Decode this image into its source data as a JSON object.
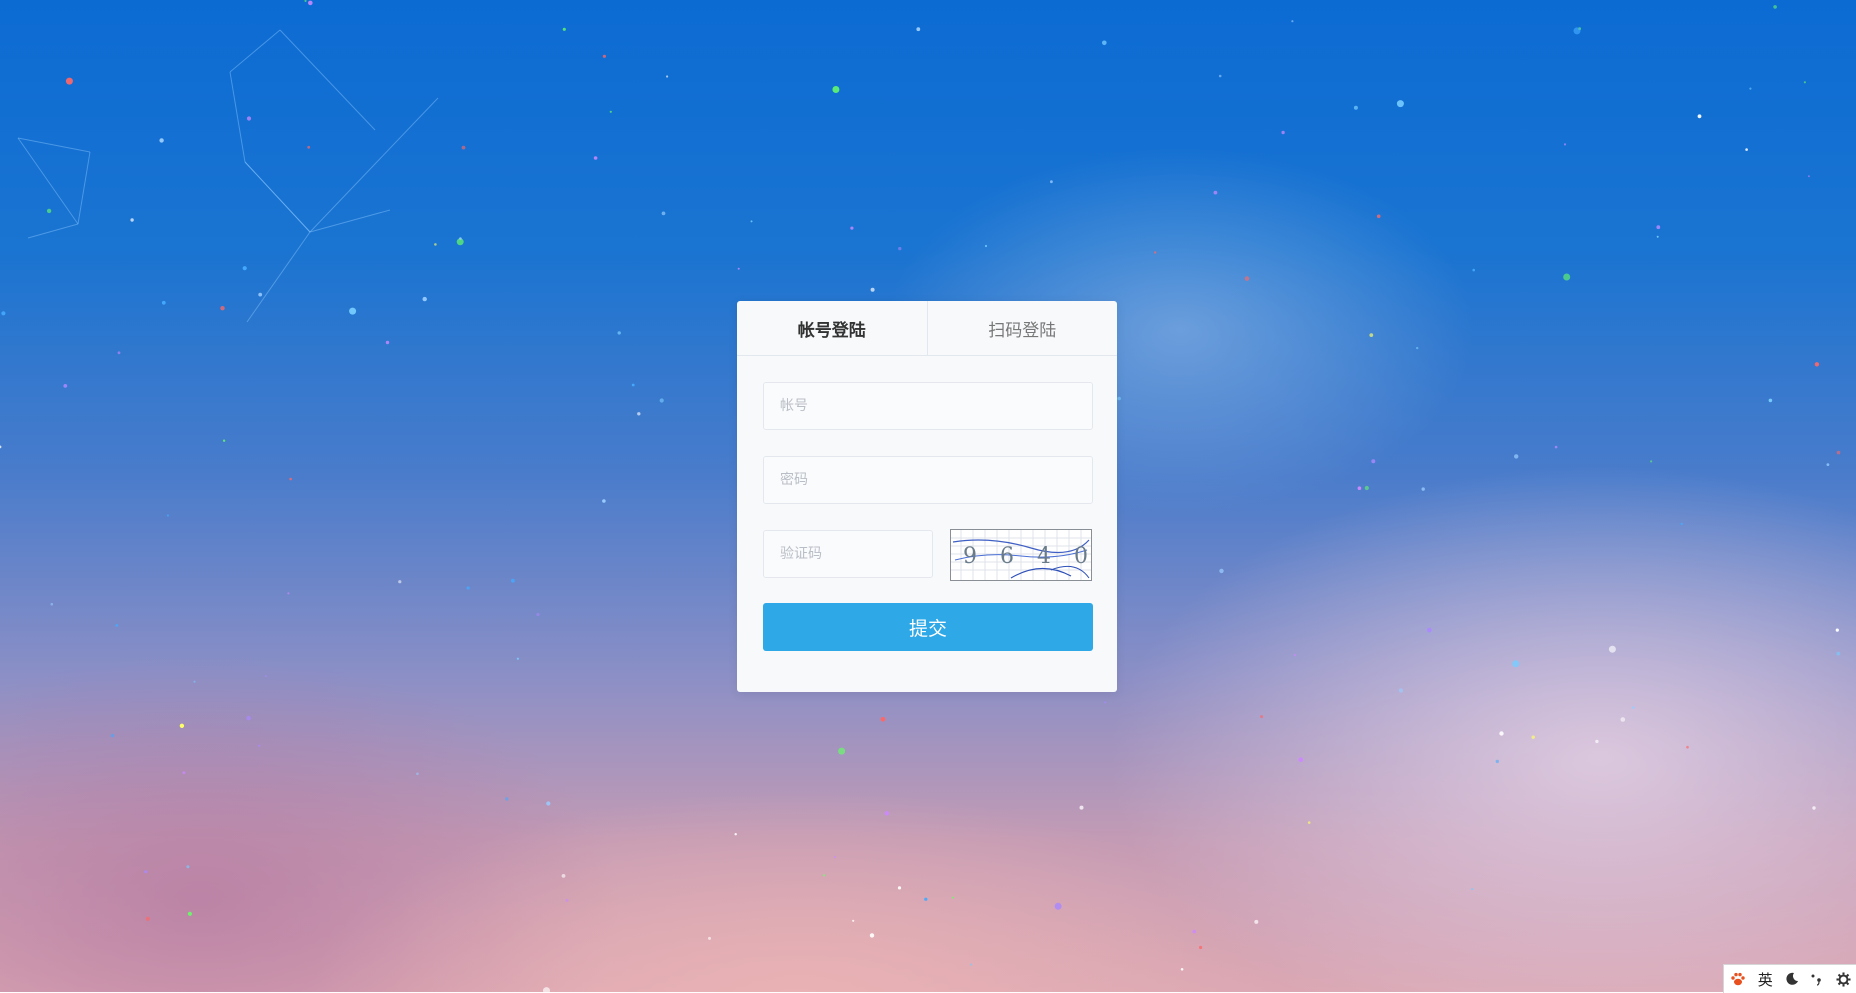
{
  "tabs": [
    {
      "label": "帐号登陆",
      "active": true
    },
    {
      "label": "扫码登陆",
      "active": false
    }
  ],
  "form": {
    "account_placeholder": "帐号",
    "password_placeholder": "密码",
    "captcha_placeholder": "验证码",
    "captcha_text": "9 6 4 0",
    "submit_label": "提交"
  },
  "ime_toolbar": {
    "logo_icon": "paw-icon",
    "lang_label": "英",
    "icons": [
      "moon-icon",
      "punctuation-icon",
      "gear-icon"
    ]
  },
  "colors": {
    "primary_button": "#2ea8e6",
    "card_background": "#f7f9fb",
    "ime_logo": "#e8501f"
  }
}
